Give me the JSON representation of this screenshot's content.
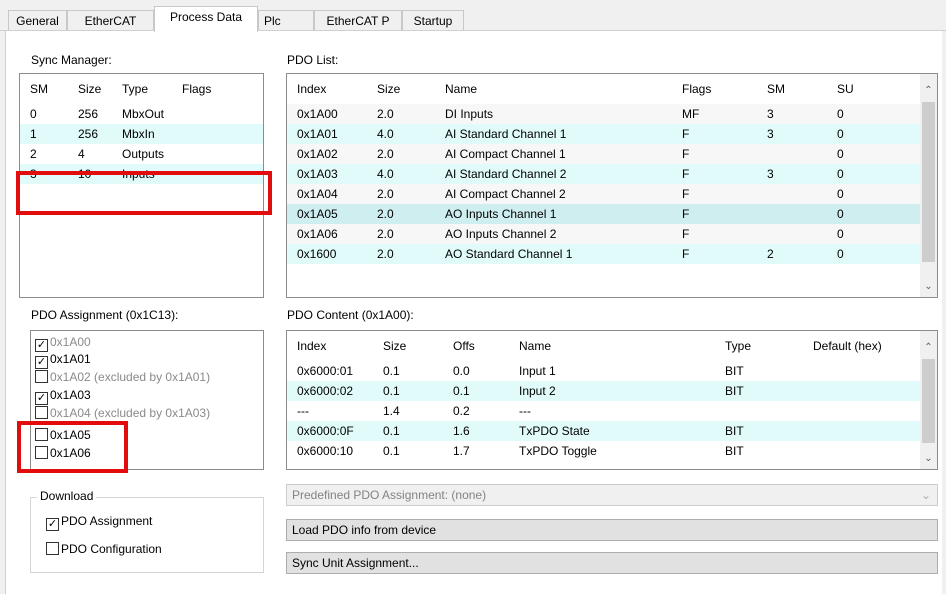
{
  "tabs": [
    {
      "label": "General"
    },
    {
      "label": "EtherCAT"
    },
    {
      "label": "Process Data"
    },
    {
      "label": "Plc"
    },
    {
      "label": "EtherCAT P"
    },
    {
      "label": "Startup"
    }
  ],
  "sync_manager": {
    "title": "Sync Manager:",
    "headers": [
      "SM",
      "Size",
      "Type",
      "Flags"
    ],
    "rows": [
      [
        "0",
        "256",
        "MbxOut",
        ""
      ],
      [
        "1",
        "256",
        "MbxIn",
        ""
      ],
      [
        "2",
        "4",
        "Outputs",
        ""
      ],
      [
        "3",
        "10",
        "Inputs",
        ""
      ]
    ]
  },
  "pdo_list": {
    "title": "PDO List:",
    "headers": [
      "Index",
      "Size",
      "Name",
      "Flags",
      "SM",
      "SU"
    ],
    "rows": [
      [
        "0x1A00",
        "2.0",
        "DI Inputs",
        "MF",
        "3",
        "0"
      ],
      [
        "0x1A01",
        "4.0",
        "AI Standard Channel 1",
        "F",
        "3",
        "0"
      ],
      [
        "0x1A02",
        "2.0",
        "AI Compact Channel 1",
        "F",
        "",
        "0"
      ],
      [
        "0x1A03",
        "4.0",
        "AI Standard Channel 2",
        "F",
        "3",
        "0"
      ],
      [
        "0x1A04",
        "2.0",
        "AI Compact Channel 2",
        "F",
        "",
        "0"
      ],
      [
        "0x1A05",
        "2.0",
        "AO Inputs Channel 1",
        "F",
        "",
        "0"
      ],
      [
        "0x1A06",
        "2.0",
        "AO Inputs Channel 2",
        "F",
        "",
        "0"
      ],
      [
        "0x1600",
        "2.0",
        "AO Standard Channel 1",
        "F",
        "2",
        "0"
      ]
    ]
  },
  "pdo_assignment": {
    "title": "PDO Assignment (0x1C13):",
    "items": [
      {
        "label": "0x1A00",
        "checked": true,
        "grey": true
      },
      {
        "label": "0x1A01",
        "checked": true,
        "grey": false
      },
      {
        "label": "0x1A02 (excluded by 0x1A01)",
        "checked": false,
        "grey": true
      },
      {
        "label": "0x1A03",
        "checked": true,
        "grey": false
      },
      {
        "label": "0x1A04 (excluded by 0x1A03)",
        "checked": false,
        "grey": true
      },
      {
        "label": "0x1A05",
        "checked": false,
        "grey": false
      },
      {
        "label": "0x1A06",
        "checked": false,
        "grey": false
      }
    ]
  },
  "pdo_content": {
    "title": "PDO Content (0x1A00):",
    "headers": [
      "Index",
      "Size",
      "Offs",
      "Name",
      "Type",
      "Default (hex)"
    ],
    "rows": [
      [
        "0x6000:01",
        "0.1",
        "0.0",
        "Input 1",
        "BIT",
        ""
      ],
      [
        "0x6000:02",
        "0.1",
        "0.1",
        "Input 2",
        "BIT",
        ""
      ],
      [
        "---",
        "1.4",
        "0.2",
        "---",
        "",
        ""
      ],
      [
        "0x6000:0F",
        "0.1",
        "1.6",
        "TxPDO State",
        "BIT",
        ""
      ],
      [
        "0x6000:10",
        "0.1",
        "1.7",
        "TxPDO Toggle",
        "BIT",
        ""
      ]
    ]
  },
  "download": {
    "title": "Download",
    "pdo_assignment_label": "PDO Assignment",
    "pdo_assignment_checked": true,
    "pdo_configuration_label": "PDO Configuration",
    "pdo_configuration_checked": false
  },
  "controls": {
    "predefined_label": "Predefined PDO Assignment: (none)",
    "load_pdo_label": "Load PDO info from device",
    "sync_unit_label": "Sync Unit Assignment..."
  },
  "colors": {
    "highlight_red": "#e20c0c",
    "row_alt_cyan": "#e1fbfb"
  }
}
